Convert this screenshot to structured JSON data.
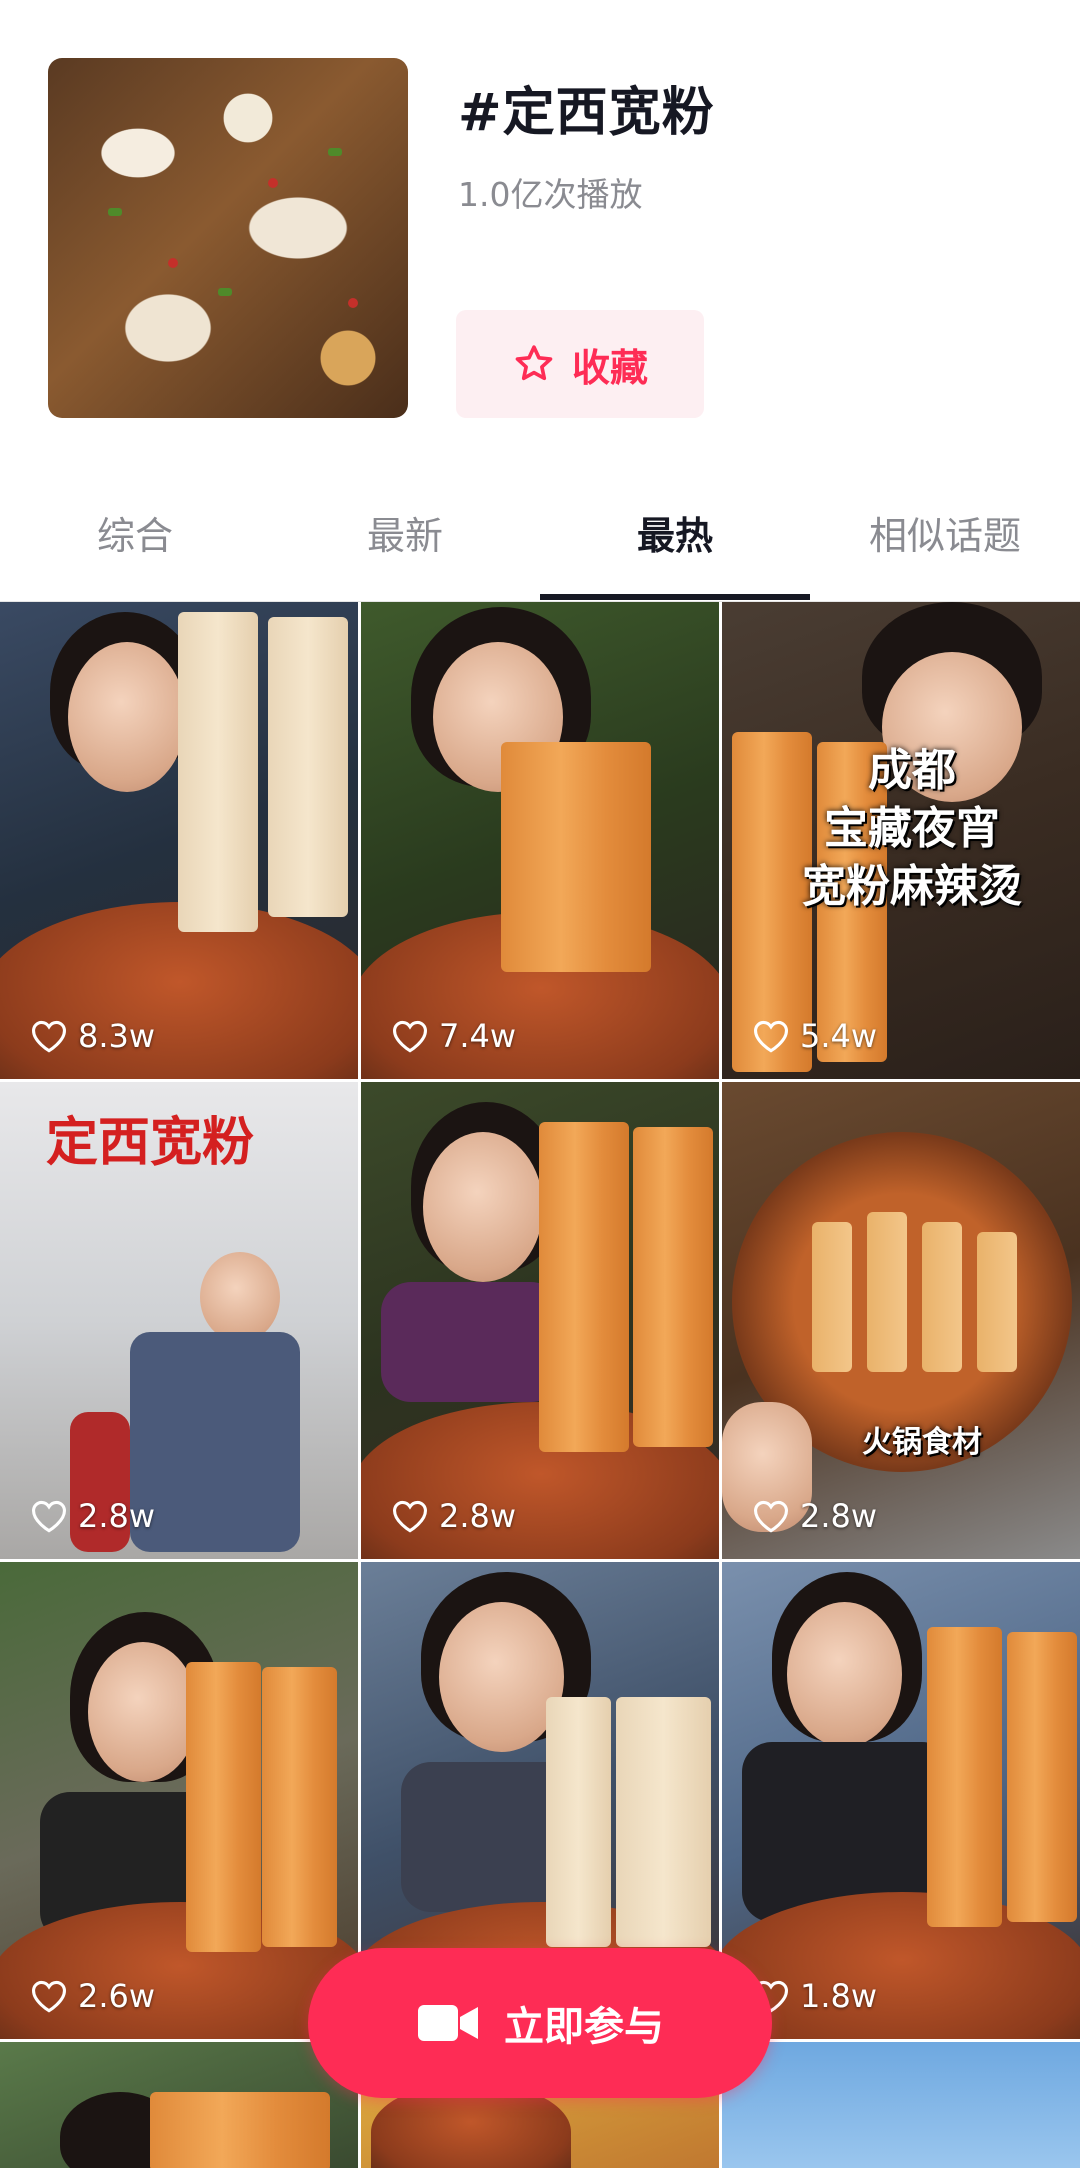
{
  "topic": {
    "title": "#定西宽粉",
    "plays": "1.0亿次播放",
    "favorite_label": "收藏"
  },
  "tabs": [
    {
      "label": "综合",
      "active": false
    },
    {
      "label": "最新",
      "active": false
    },
    {
      "label": "最热",
      "active": true
    },
    {
      "label": "相似话题",
      "active": false
    }
  ],
  "videos": [
    {
      "likes": "8.3w"
    },
    {
      "likes": "7.4w"
    },
    {
      "likes": "5.4w",
      "overlay": [
        "成都",
        "宝藏夜宵",
        "宽粉麻辣烫"
      ]
    },
    {
      "likes": "2.8w",
      "overlay": [
        "定西宽粉"
      ]
    },
    {
      "likes": "2.8w"
    },
    {
      "likes": "2.8w",
      "overlay": [
        "火锅食材"
      ]
    },
    {
      "likes": "2.6w"
    },
    {
      "likes": ""
    },
    {
      "likes": "1.8w"
    }
  ],
  "join_button": {
    "label": "立即参与"
  },
  "colors": {
    "accent": "#fe2c55",
    "text_primary": "#161823",
    "text_secondary": "#8a8b91"
  }
}
